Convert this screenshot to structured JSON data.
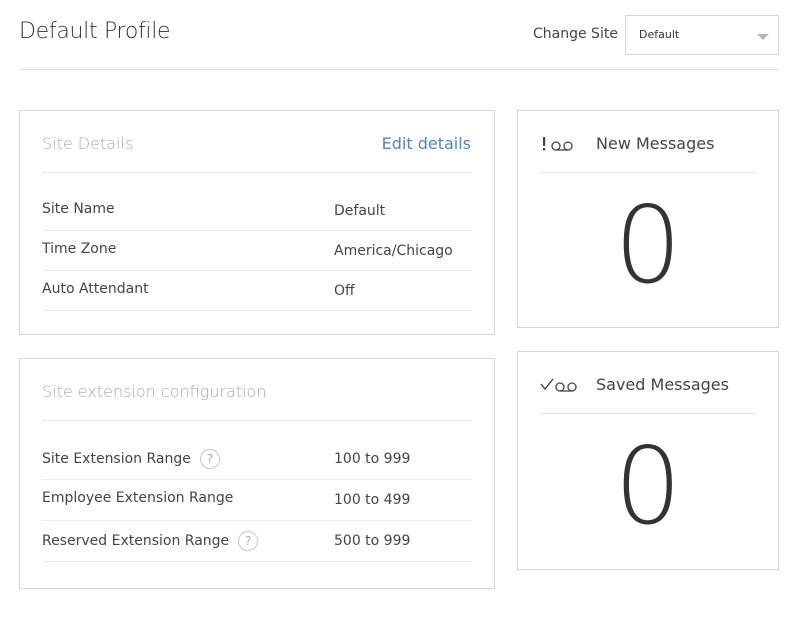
{
  "header": {
    "title": "Default Profile",
    "change_site_label": "Change Site",
    "site_select_value": "Default"
  },
  "site_details": {
    "title": "Site Details",
    "edit_label": "Edit details",
    "rows": [
      {
        "label": "Site Name",
        "value": "Default"
      },
      {
        "label": "Time Zone",
        "value": "America/Chicago"
      },
      {
        "label": "Auto Attendant",
        "value": "Off"
      }
    ]
  },
  "site_extension": {
    "title": "Site extension configuration",
    "help_glyph": "?",
    "rows": [
      {
        "label": "Site Extension Range",
        "value": "100 to 999",
        "help": true
      },
      {
        "label": "Employee Extension Range",
        "value": "100 to 499",
        "help": false
      },
      {
        "label": "Reserved Extension Range",
        "value": "500 to 999",
        "help": true
      }
    ]
  },
  "new_messages": {
    "icon": "voicemail-new-icon",
    "title": "New Messages",
    "count": "0"
  },
  "saved_messages": {
    "icon": "voicemail-saved-icon",
    "title": "Saved Messages",
    "count": "0"
  },
  "colors": {
    "link": "#4a86c8",
    "border": "#d6d6d6",
    "muted_title": "#a8a8a8"
  }
}
